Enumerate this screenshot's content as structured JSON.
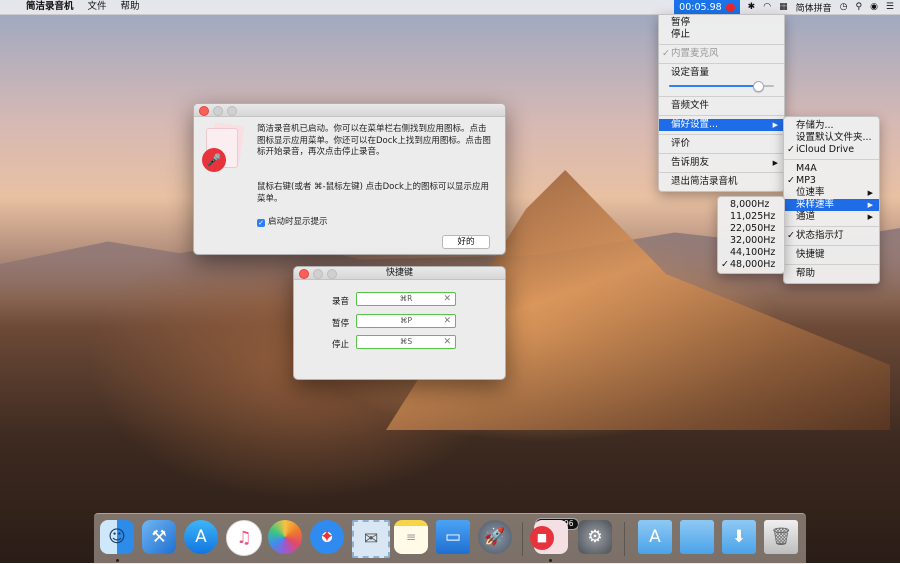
{
  "menubar": {
    "apple": "",
    "app_name": "简洁录音机",
    "menus": [
      "文件",
      "帮助"
    ],
    "timer": "00:05.98",
    "input_method": "简体拼音"
  },
  "app_menu": {
    "items": [
      {
        "label": "暂停"
      },
      {
        "label": "停止"
      },
      {
        "label": "内置麦克风",
        "checked": true,
        "disabled": true
      },
      {
        "label": "设定音量"
      },
      {
        "label": "音频文件"
      },
      {
        "label": "偏好设置...",
        "selected": true,
        "submenu": true
      },
      {
        "label": "评价"
      },
      {
        "label": "告诉朋友",
        "submenu": true
      },
      {
        "label": "退出简洁录音机"
      }
    ],
    "volume": 0.85
  },
  "prefs_menu": {
    "items": [
      {
        "label": "存储为..."
      },
      {
        "label": "设置默认文件夹..."
      },
      {
        "label": "iCloud Drive",
        "checked": true
      },
      {
        "label": "M4A"
      },
      {
        "label": "MP3",
        "checked": true
      },
      {
        "label": "位速率",
        "submenu": true
      },
      {
        "label": "采样速率",
        "selected": true,
        "submenu": true
      },
      {
        "label": "通道",
        "submenu": true
      },
      {
        "label": "状态指示灯",
        "checked": true
      },
      {
        "label": "快捷键"
      },
      {
        "label": "帮助"
      }
    ]
  },
  "sample_rate_menu": {
    "items": [
      {
        "label": "8,000Hz"
      },
      {
        "label": "11,025Hz"
      },
      {
        "label": "22,050Hz"
      },
      {
        "label": "32,000Hz"
      },
      {
        "label": "44,100Hz"
      },
      {
        "label": "48,000Hz",
        "checked": true
      }
    ]
  },
  "alert": {
    "message": "简洁录音机已启动。你可以在菜单栏右侧找到应用图标。点击图标显示应用菜单。你还可以在Dock上找到应用图标。点击图标开始录音，再次点击停止录音。",
    "hint": "鼠标右键(或者 ⌘-鼠标左键) 点击Dock上的图标可以显示应用菜单。",
    "checkbox_label": "启动时显示提示",
    "ok_label": "好的"
  },
  "shortcuts_window": {
    "title": "快捷键",
    "rows": [
      {
        "label": "录音",
        "key": "⌘R"
      },
      {
        "label": "暂停",
        "key": "⌘P"
      },
      {
        "label": "停止",
        "key": "⌘S"
      }
    ]
  },
  "dock": {
    "timer": "00:05.96",
    "icons": [
      "finder-icon",
      "xcode-icon",
      "app-store-icon",
      "itunes-icon",
      "photos-icon",
      "safari-icon",
      "mail-stamp-icon",
      "notes-icon",
      "keynote-icon",
      "launchpad-icon",
      "recorder-icon",
      "system-preferences-icon",
      "applications-folder-icon",
      "documents-folder-icon",
      "downloads-folder-icon",
      "trash-icon"
    ]
  },
  "colors": {
    "accent": "#1f6ce8",
    "record_red": "#e6333c",
    "shortcut_border": "#58c24a"
  }
}
